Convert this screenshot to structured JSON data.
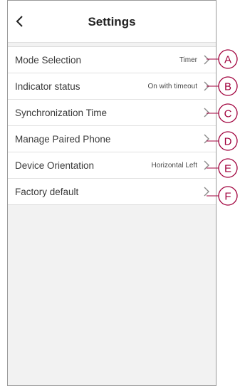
{
  "header": {
    "title": "Settings",
    "back_icon": "chevron-left-icon"
  },
  "settings": [
    {
      "label": "Mode Selection",
      "value": "Timer",
      "callout": "A"
    },
    {
      "label": "Indicator status",
      "value": "On with timeout",
      "callout": "B"
    },
    {
      "label": "Synchronization Time",
      "value": "",
      "callout": "C"
    },
    {
      "label": "Manage Paired Phone",
      "value": "",
      "callout": "D"
    },
    {
      "label": "Device Orientation",
      "value": "Horizontal Left",
      "callout": "E"
    },
    {
      "label": "Factory default",
      "value": "",
      "callout": "F"
    }
  ],
  "colors": {
    "callout": "#a0003c",
    "background": "#f2f2f2",
    "row_background": "#ffffff"
  }
}
